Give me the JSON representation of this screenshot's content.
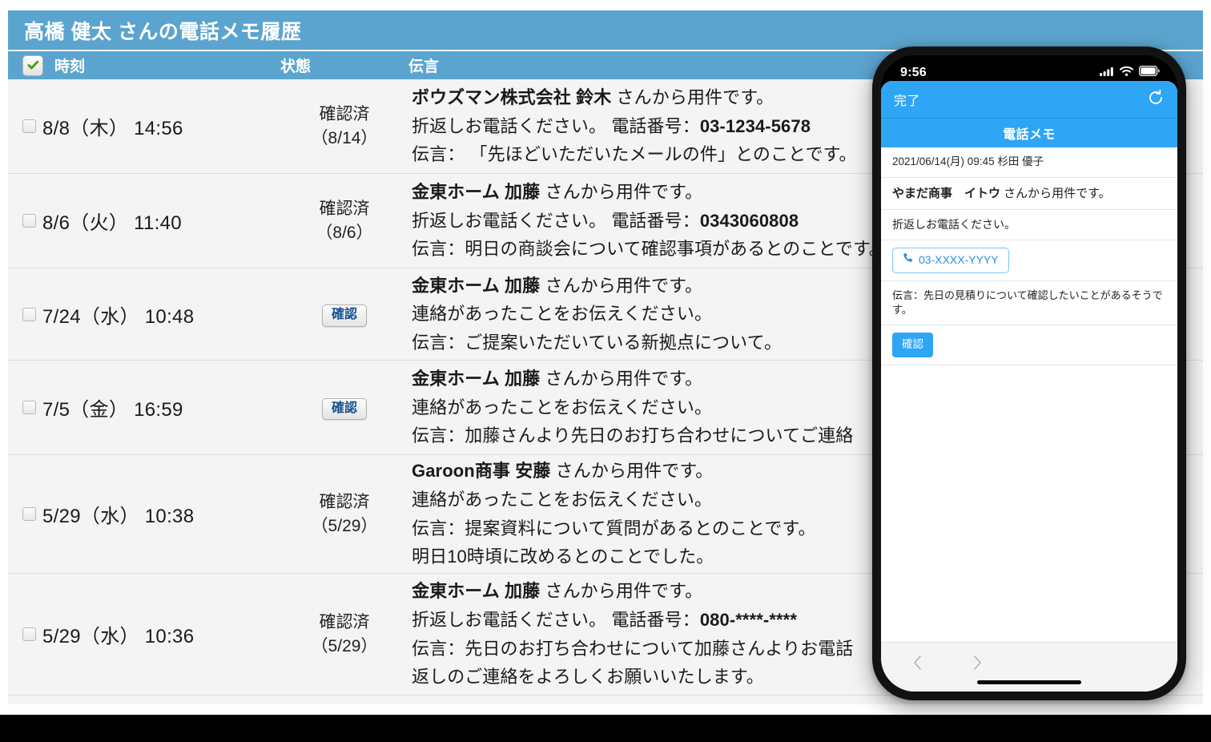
{
  "app": {
    "title": "高橋 健太 さんの電話メモ履歴",
    "header_checkbox_icon": "check-icon",
    "columns": {
      "time": "時刻",
      "state": "状態",
      "message": "伝言"
    },
    "accent_color": "#5ba4cf",
    "row_bg_color": "#f4f4f4"
  },
  "rows": [
    {
      "time": "8/8（木） 14:56",
      "state_lines": [
        "確認済",
        "（8/14）"
      ],
      "has_confirm_button": false,
      "confirm_label": "",
      "message_lines": [
        {
          "bold": "ボウズマン株式会社 鈴木",
          "rest": " さんから用件です。"
        },
        {
          "bold": "",
          "rest": "折返しお電話ください。 電話番号：",
          "tail_bold": "03-1234-5678"
        },
        {
          "bold": "",
          "rest": "伝言： 「先ほどいただいたメールの件」とのことです。"
        }
      ]
    },
    {
      "time": "8/6（火） 11:40",
      "state_lines": [
        "確認済",
        "（8/6）"
      ],
      "has_confirm_button": false,
      "confirm_label": "",
      "message_lines": [
        {
          "bold": "金東ホーム 加藤",
          "rest": " さんから用件です。"
        },
        {
          "bold": "",
          "rest": "折返しお電話ください。 電話番号：",
          "tail_bold": "0343060808"
        },
        {
          "bold": "",
          "rest": "伝言：明日の商談会について確認事項があるとのことです。"
        }
      ]
    },
    {
      "time": "7/24（水） 10:48",
      "state_lines": [],
      "has_confirm_button": true,
      "confirm_label": "確認",
      "message_lines": [
        {
          "bold": "金東ホーム 加藤",
          "rest": " さんから用件です。"
        },
        {
          "bold": "",
          "rest": "連絡があったことをお伝えください。"
        },
        {
          "bold": "",
          "rest": "伝言：ご提案いただいている新拠点について。"
        }
      ]
    },
    {
      "time": "7/5（金） 16:59",
      "state_lines": [],
      "has_confirm_button": true,
      "confirm_label": "確認",
      "message_lines": [
        {
          "bold": "金東ホーム 加藤",
          "rest": " さんから用件です。"
        },
        {
          "bold": "",
          "rest": "連絡があったことをお伝えください。"
        },
        {
          "bold": "",
          "rest": "伝言：加藤さんより先日のお打ち合わせについてご連絡"
        }
      ]
    },
    {
      "time": "5/29（水） 10:38",
      "state_lines": [
        "確認済",
        "（5/29）"
      ],
      "has_confirm_button": false,
      "confirm_label": "",
      "message_lines": [
        {
          "bold": "Garoon商事 安藤",
          "rest": " さんから用件です。"
        },
        {
          "bold": "",
          "rest": "連絡があったことをお伝えください。"
        },
        {
          "bold": "",
          "rest": "伝言：提案資料について質問があるとのことです。"
        },
        {
          "bold": "",
          "rest": "明日10時頃に改めるとのことでした。"
        }
      ]
    },
    {
      "time": "5/29（水） 10:36",
      "state_lines": [
        "確認済",
        "（5/29）"
      ],
      "has_confirm_button": false,
      "confirm_label": "",
      "message_lines": [
        {
          "bold": "金東ホーム 加藤",
          "rest": " さんから用件です。"
        },
        {
          "bold": "",
          "rest": "折返しお電話ください。 電話番号：",
          "tail_bold": "080-****-****"
        },
        {
          "bold": "",
          "rest": "伝言：先日のお打ち合わせについて加藤さんよりお電話"
        },
        {
          "bold": "",
          "rest": "返しのご連絡をよろしくお願いいたします。"
        }
      ]
    }
  ],
  "phone": {
    "status": {
      "time": "9:56",
      "signal_icon": "signal-bars-icon",
      "wifi_icon": "wifi-icon",
      "battery_icon": "battery-icon"
    },
    "nav": {
      "done_label": "完了",
      "refresh_icon": "refresh-icon"
    },
    "sub_title": "電話メモ",
    "accent_color": "#2ea6f5",
    "detail": {
      "meta": "2021/06/14(月) 09:45  杉田 優子",
      "sender_bold": "やまだ商事　イトウ",
      "sender_rest": " さんから用件です。",
      "instruction": "折返しお電話ください。",
      "phone_icon": "phone-icon",
      "phone_number": "03-XXXX-YYYY",
      "message": "伝言：先日の見積りについて確認したいことがあるそうです。",
      "confirm_label": "確認"
    },
    "footer": {
      "back_icon": "chevron-left-icon",
      "forward_icon": "chevron-right-icon"
    }
  }
}
